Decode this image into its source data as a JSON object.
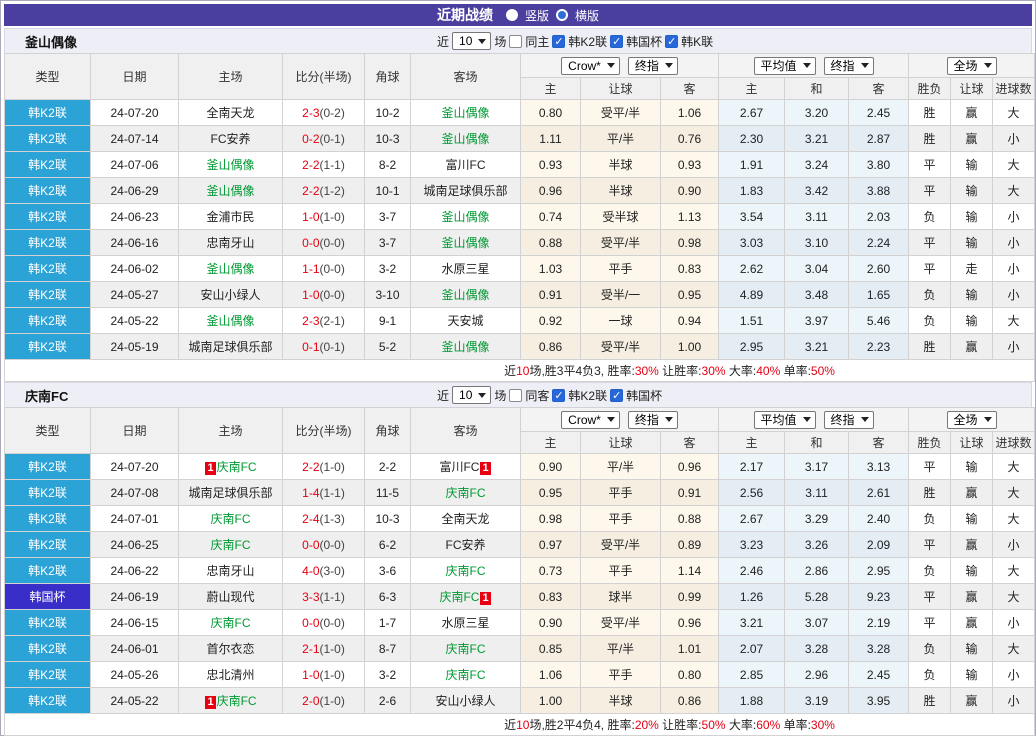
{
  "colors": {
    "header_purple": "#4a3f9e",
    "league_k2_blue": "#2ba3d7",
    "league_cup_purple": "#3a2ec8",
    "team_green": "#009933",
    "score_red": "#e60012",
    "win_red": "#e60012",
    "lose_blue": "#2929cc",
    "draw_green": "#009933",
    "checkbox_blue": "#2767d9"
  },
  "title_bar": {
    "title": "近期战绩",
    "vertical": "竖版",
    "horizontal": "横版"
  },
  "left_headers": [
    "类型",
    "日期",
    "主场",
    "比分(半场)",
    "角球",
    "客场"
  ],
  "sub_headers": [
    "主",
    "让球",
    "客",
    "主",
    "和",
    "客",
    "胜负",
    "让球",
    "进球数"
  ],
  "dropdowns": [
    "Crow*",
    "终指",
    "平均值",
    "终指",
    "全场"
  ],
  "filter_labels": {
    "near": "近",
    "unit": "场"
  },
  "sections": [
    {
      "team": "釜山偶像",
      "filter": {
        "games": "10",
        "same": "同主",
        "leagues": [
          "韩K2联",
          "韩国杯",
          "韩K联"
        ]
      },
      "rows": [
        {
          "lg": "韩K2联",
          "cup": false,
          "date": "24-07-20",
          "home": "全南天龙",
          "hg": false,
          "hc": null,
          "away": "釜山偶像",
          "ag": true,
          "ac": null,
          "ft": "2-3",
          "ht": "(0-2)",
          "cn": "10-2",
          "o": [
            "0.80",
            "受平/半",
            "1.06",
            "2.67",
            "3.20",
            "2.45"
          ],
          "r": [
            [
              "胜",
              "r"
            ],
            [
              "赢",
              "r"
            ],
            [
              "大",
              "r"
            ]
          ]
        },
        {
          "lg": "韩K2联",
          "cup": false,
          "date": "24-07-14",
          "home": "FC安养",
          "hg": false,
          "hc": null,
          "away": "釜山偶像",
          "ag": true,
          "ac": null,
          "ft": "0-2",
          "ht": "(0-1)",
          "cn": "10-3",
          "o": [
            "1.11",
            "平/半",
            "0.76",
            "2.30",
            "3.21",
            "2.87"
          ],
          "r": [
            [
              "胜",
              "r"
            ],
            [
              "赢",
              "r"
            ],
            [
              "小",
              "b"
            ]
          ]
        },
        {
          "lg": "韩K2联",
          "cup": false,
          "date": "24-07-06",
          "home": "釜山偶像",
          "hg": true,
          "hc": null,
          "away": "富川FC",
          "ag": false,
          "ac": null,
          "ft": "2-2",
          "ht": "(1-1)",
          "cn": "8-2",
          "o": [
            "0.93",
            "半球",
            "0.93",
            "1.91",
            "3.24",
            "3.80"
          ],
          "r": [
            [
              "平",
              "g"
            ],
            [
              "输",
              "b"
            ],
            [
              "大",
              "r"
            ]
          ]
        },
        {
          "lg": "韩K2联",
          "cup": false,
          "date": "24-06-29",
          "home": "釜山偶像",
          "hg": true,
          "hc": null,
          "away": "城南足球俱乐部",
          "ag": false,
          "ac": null,
          "ft": "2-2",
          "ht": "(1-2)",
          "cn": "10-1",
          "o": [
            "0.96",
            "半球",
            "0.90",
            "1.83",
            "3.42",
            "3.88"
          ],
          "r": [
            [
              "平",
              "g"
            ],
            [
              "输",
              "b"
            ],
            [
              "大",
              "r"
            ]
          ]
        },
        {
          "lg": "韩K2联",
          "cup": false,
          "date": "24-06-23",
          "home": "金浦市民",
          "hg": false,
          "hc": null,
          "away": "釜山偶像",
          "ag": true,
          "ac": null,
          "ft": "1-0",
          "ht": "(1-0)",
          "cn": "3-7",
          "o": [
            "0.74",
            "受半球",
            "1.13",
            "3.54",
            "3.11",
            "2.03"
          ],
          "r": [
            [
              "负",
              "b"
            ],
            [
              "输",
              "b"
            ],
            [
              "小",
              "b"
            ]
          ]
        },
        {
          "lg": "韩K2联",
          "cup": false,
          "date": "24-06-16",
          "home": "忠南牙山",
          "hg": false,
          "hc": null,
          "away": "釜山偶像",
          "ag": true,
          "ac": null,
          "ft": "0-0",
          "ht": "(0-0)",
          "cn": "3-7",
          "o": [
            "0.88",
            "受平/半",
            "0.98",
            "3.03",
            "3.10",
            "2.24"
          ],
          "r": [
            [
              "平",
              "g"
            ],
            [
              "输",
              "b"
            ],
            [
              "小",
              "b"
            ]
          ]
        },
        {
          "lg": "韩K2联",
          "cup": false,
          "date": "24-06-02",
          "home": "釜山偶像",
          "hg": true,
          "hc": null,
          "away": "水原三星",
          "ag": false,
          "ac": null,
          "ft": "1-1",
          "ht": "(0-0)",
          "cn": "3-2",
          "o": [
            "1.03",
            "平手",
            "0.83",
            "2.62",
            "3.04",
            "2.60"
          ],
          "r": [
            [
              "平",
              "g"
            ],
            [
              "走",
              "g"
            ],
            [
              "小",
              "b"
            ]
          ]
        },
        {
          "lg": "韩K2联",
          "cup": false,
          "date": "24-05-27",
          "home": "安山小绿人",
          "hg": false,
          "hc": null,
          "away": "釜山偶像",
          "ag": true,
          "ac": null,
          "ft": "1-0",
          "ht": "(0-0)",
          "cn": "3-10",
          "o": [
            "0.91",
            "受半/一",
            "0.95",
            "4.89",
            "3.48",
            "1.65"
          ],
          "r": [
            [
              "负",
              "b"
            ],
            [
              "输",
              "b"
            ],
            [
              "小",
              "b"
            ]
          ]
        },
        {
          "lg": "韩K2联",
          "cup": false,
          "date": "24-05-22",
          "home": "釜山偶像",
          "hg": true,
          "hc": null,
          "away": "天安城",
          "ag": false,
          "ac": null,
          "ft": "2-3",
          "ht": "(2-1)",
          "cn": "9-1",
          "o": [
            "0.92",
            "一球",
            "0.94",
            "1.51",
            "3.97",
            "5.46"
          ],
          "r": [
            [
              "负",
              "b"
            ],
            [
              "输",
              "b"
            ],
            [
              "大",
              "r"
            ]
          ]
        },
        {
          "lg": "韩K2联",
          "cup": false,
          "date": "24-05-19",
          "home": "城南足球俱乐部",
          "hg": false,
          "hc": null,
          "away": "釜山偶像",
          "ag": true,
          "ac": null,
          "ft": "0-1",
          "ht": "(0-1)",
          "cn": "5-2",
          "o": [
            "0.86",
            "受平/半",
            "1.00",
            "2.95",
            "3.21",
            "2.23"
          ],
          "r": [
            [
              "胜",
              "r"
            ],
            [
              "赢",
              "r"
            ],
            [
              "小",
              "b"
            ]
          ]
        }
      ],
      "summary": [
        {
          "t": "近"
        },
        {
          "t": "10",
          "red": true
        },
        {
          "t": "场,胜3平4负3, 胜率:"
        },
        {
          "t": "30%",
          "red": true
        },
        {
          "t": " 让胜率:"
        },
        {
          "t": "30%",
          "red": true
        },
        {
          "t": " 大率:"
        },
        {
          "t": "40%",
          "red": true
        },
        {
          "t": " 单率:"
        },
        {
          "t": "50%",
          "red": true
        }
      ]
    },
    {
      "team": "庆南FC",
      "filter": {
        "games": "10",
        "same": "同客",
        "leagues": [
          "韩K2联",
          "韩国杯"
        ]
      },
      "rows": [
        {
          "lg": "韩K2联",
          "cup": false,
          "date": "24-07-20",
          "home": "庆南FC",
          "hg": true,
          "hc": "before",
          "away": "富川FC",
          "ag": false,
          "ac": "after",
          "ft": "2-2",
          "ht": "(1-0)",
          "cn": "2-2",
          "o": [
            "0.90",
            "平/半",
            "0.96",
            "2.17",
            "3.17",
            "3.13"
          ],
          "r": [
            [
              "平",
              "g"
            ],
            [
              "输",
              "b"
            ],
            [
              "大",
              "r"
            ]
          ]
        },
        {
          "lg": "韩K2联",
          "cup": false,
          "date": "24-07-08",
          "home": "城南足球俱乐部",
          "hg": false,
          "hc": null,
          "away": "庆南FC",
          "ag": true,
          "ac": null,
          "ft": "1-4",
          "ht": "(1-1)",
          "cn": "11-5",
          "o": [
            "0.95",
            "平手",
            "0.91",
            "2.56",
            "3.11",
            "2.61"
          ],
          "r": [
            [
              "胜",
              "r"
            ],
            [
              "赢",
              "r"
            ],
            [
              "大",
              "r"
            ]
          ]
        },
        {
          "lg": "韩K2联",
          "cup": false,
          "date": "24-07-01",
          "home": "庆南FC",
          "hg": true,
          "hc": null,
          "away": "全南天龙",
          "ag": false,
          "ac": null,
          "ft": "2-4",
          "ht": "(1-3)",
          "cn": "10-3",
          "o": [
            "0.98",
            "平手",
            "0.88",
            "2.67",
            "3.29",
            "2.40"
          ],
          "r": [
            [
              "负",
              "b"
            ],
            [
              "输",
              "b"
            ],
            [
              "大",
              "r"
            ]
          ]
        },
        {
          "lg": "韩K2联",
          "cup": false,
          "date": "24-06-25",
          "home": "庆南FC",
          "hg": true,
          "hc": null,
          "away": "FC安养",
          "ag": false,
          "ac": null,
          "ft": "0-0",
          "ht": "(0-0)",
          "cn": "6-2",
          "o": [
            "0.97",
            "受平/半",
            "0.89",
            "3.23",
            "3.26",
            "2.09"
          ],
          "r": [
            [
              "平",
              "g"
            ],
            [
              "赢",
              "r"
            ],
            [
              "小",
              "b"
            ]
          ]
        },
        {
          "lg": "韩K2联",
          "cup": false,
          "date": "24-06-22",
          "home": "忠南牙山",
          "hg": false,
          "hc": null,
          "away": "庆南FC",
          "ag": true,
          "ac": null,
          "ft": "4-0",
          "ht": "(3-0)",
          "cn": "3-6",
          "o": [
            "0.73",
            "平手",
            "1.14",
            "2.46",
            "2.86",
            "2.95"
          ],
          "r": [
            [
              "负",
              "b"
            ],
            [
              "输",
              "b"
            ],
            [
              "大",
              "r"
            ]
          ]
        },
        {
          "lg": "韩国杯",
          "cup": true,
          "date": "24-06-19",
          "home": "蔚山现代",
          "hg": false,
          "hc": null,
          "away": "庆南FC",
          "ag": true,
          "ac": "after",
          "ft": "3-3",
          "ht": "(1-1)",
          "cn": "6-3",
          "o": [
            "0.83",
            "球半",
            "0.99",
            "1.26",
            "5.28",
            "9.23"
          ],
          "r": [
            [
              "平",
              "g"
            ],
            [
              "赢",
              "r"
            ],
            [
              "大",
              "r"
            ]
          ]
        },
        {
          "lg": "韩K2联",
          "cup": false,
          "date": "24-06-15",
          "home": "庆南FC",
          "hg": true,
          "hc": null,
          "away": "水原三星",
          "ag": false,
          "ac": null,
          "ft": "0-0",
          "ht": "(0-0)",
          "cn": "1-7",
          "o": [
            "0.90",
            "受平/半",
            "0.96",
            "3.21",
            "3.07",
            "2.19"
          ],
          "r": [
            [
              "平",
              "g"
            ],
            [
              "赢",
              "r"
            ],
            [
              "小",
              "b"
            ]
          ]
        },
        {
          "lg": "韩K2联",
          "cup": false,
          "date": "24-06-01",
          "home": "首尔衣恋",
          "hg": false,
          "hc": null,
          "away": "庆南FC",
          "ag": true,
          "ac": null,
          "ft": "2-1",
          "ht": "(1-0)",
          "cn": "8-7",
          "o": [
            "0.85",
            "平/半",
            "1.01",
            "2.07",
            "3.28",
            "3.28"
          ],
          "r": [
            [
              "负",
              "b"
            ],
            [
              "输",
              "b"
            ],
            [
              "大",
              "r"
            ]
          ]
        },
        {
          "lg": "韩K2联",
          "cup": false,
          "date": "24-05-26",
          "home": "忠北清州",
          "hg": false,
          "hc": null,
          "away": "庆南FC",
          "ag": true,
          "ac": null,
          "ft": "1-0",
          "ht": "(1-0)",
          "cn": "3-2",
          "o": [
            "1.06",
            "平手",
            "0.80",
            "2.85",
            "2.96",
            "2.45"
          ],
          "r": [
            [
              "负",
              "b"
            ],
            [
              "输",
              "b"
            ],
            [
              "小",
              "b"
            ]
          ]
        },
        {
          "lg": "韩K2联",
          "cup": false,
          "date": "24-05-22",
          "home": "庆南FC",
          "hg": true,
          "hc": "before",
          "away": "安山小绿人",
          "ag": false,
          "ac": null,
          "ft": "2-0",
          "ht": "(1-0)",
          "cn": "2-6",
          "o": [
            "1.00",
            "半球",
            "0.86",
            "1.88",
            "3.19",
            "3.95"
          ],
          "r": [
            [
              "胜",
              "r"
            ],
            [
              "赢",
              "r"
            ],
            [
              "小",
              "b"
            ]
          ]
        }
      ],
      "summary": [
        {
          "t": "近"
        },
        {
          "t": "10",
          "red": true
        },
        {
          "t": "场,胜2平4负4, 胜率:"
        },
        {
          "t": "20%",
          "red": true
        },
        {
          "t": " 让胜率:"
        },
        {
          "t": "50%",
          "red": true
        },
        {
          "t": " 大率:"
        },
        {
          "t": "60%",
          "red": true
        },
        {
          "t": " 单率:"
        },
        {
          "t": "30%",
          "red": true
        }
      ]
    }
  ],
  "red_card_badge": "1"
}
